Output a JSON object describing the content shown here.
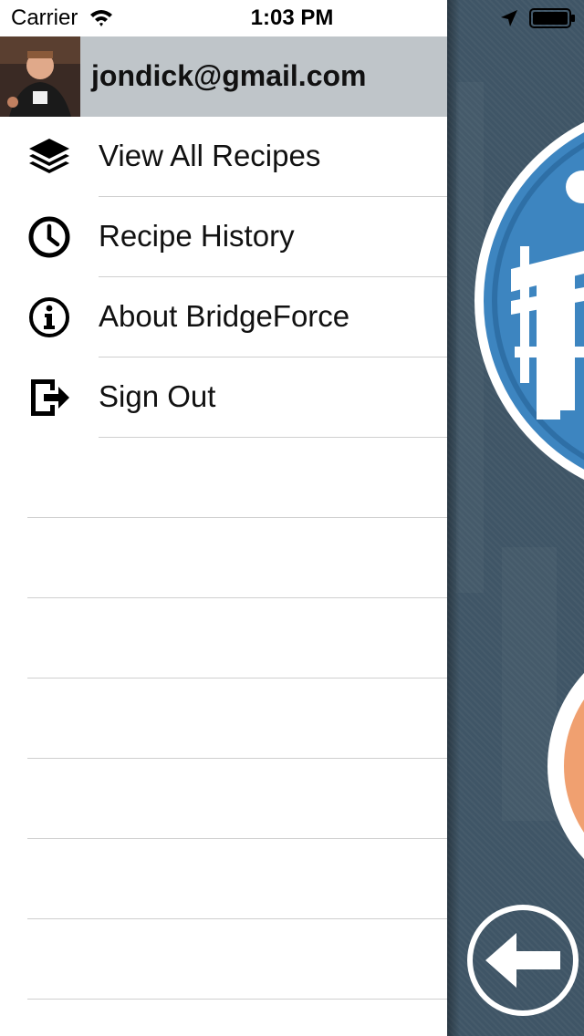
{
  "status_bar": {
    "carrier": "Carrier",
    "time": "1:03 PM"
  },
  "profile": {
    "email": "jondick@gmail.com"
  },
  "menu": [
    {
      "label": "View All Recipes",
      "icon": "layers-icon"
    },
    {
      "label": "Recipe History",
      "icon": "clock-icon"
    },
    {
      "label": "About BridgeForce",
      "icon": "info-icon"
    },
    {
      "label": "Sign Out",
      "icon": "sign-out-icon"
    }
  ],
  "colors": {
    "header_background": "#bfc5c9",
    "panel_background": "#3f5566",
    "logo_blue": "#3d85c0",
    "accent_orange": "#f0a070"
  }
}
